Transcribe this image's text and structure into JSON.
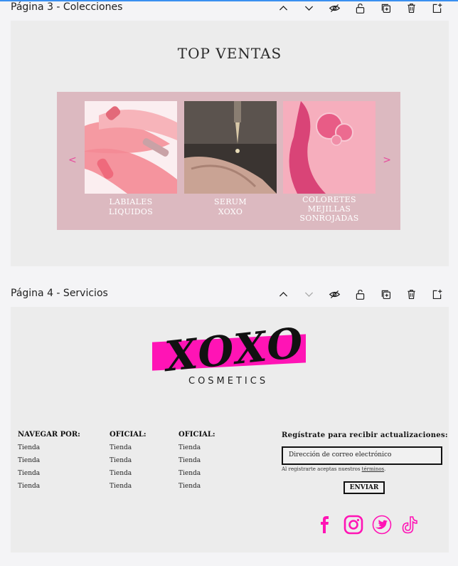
{
  "pages": [
    {
      "title": "Página 3 - Colecciones"
    },
    {
      "title": "Página 4 - Servicios"
    }
  ],
  "toolbar_icons": [
    "chevron-up-icon",
    "chevron-down-icon",
    "hide-icon",
    "lock-icon",
    "duplicate-icon",
    "trash-icon",
    "add-page-icon"
  ],
  "page3": {
    "heading": "TOP VENTAS",
    "prev": "<",
    "next": ">",
    "cards": [
      {
        "line1": "LABIALES",
        "line2": "LIQUIDOS",
        "line3": ""
      },
      {
        "line1": "SERUM",
        "line2": "XOXO",
        "line3": ""
      },
      {
        "line1": "COLORETES",
        "line2": "MEJILLAS",
        "line3": "SONROJADAS"
      }
    ]
  },
  "page4": {
    "logo": "XOXO",
    "logo_sub": "COSMETICS",
    "columns": [
      {
        "head": "NAVEGAR POR:",
        "items": [
          "Tienda",
          "Tienda",
          "Tienda",
          "Tienda"
        ]
      },
      {
        "head": "OFICIAL:",
        "items": [
          "Tienda",
          "Tienda",
          "Tienda",
          "Tienda"
        ]
      },
      {
        "head": "OFICIAL:",
        "items": [
          "Tienda",
          "Tienda",
          "Tienda",
          "Tienda"
        ]
      }
    ],
    "register_title": "Regístrate para recibir actualizaciones:",
    "email_placeholder": "Dirección de correo electrónico",
    "terms_prefix": "Al registrarte aceptas nuestros ",
    "terms_link": "términos",
    "terms_suffix": ".",
    "send_label": "ENVIAR",
    "socials": [
      "facebook-icon",
      "instagram-icon",
      "twitter-icon",
      "tiktok-icon"
    ],
    "brand_color": "#ff14b5"
  }
}
